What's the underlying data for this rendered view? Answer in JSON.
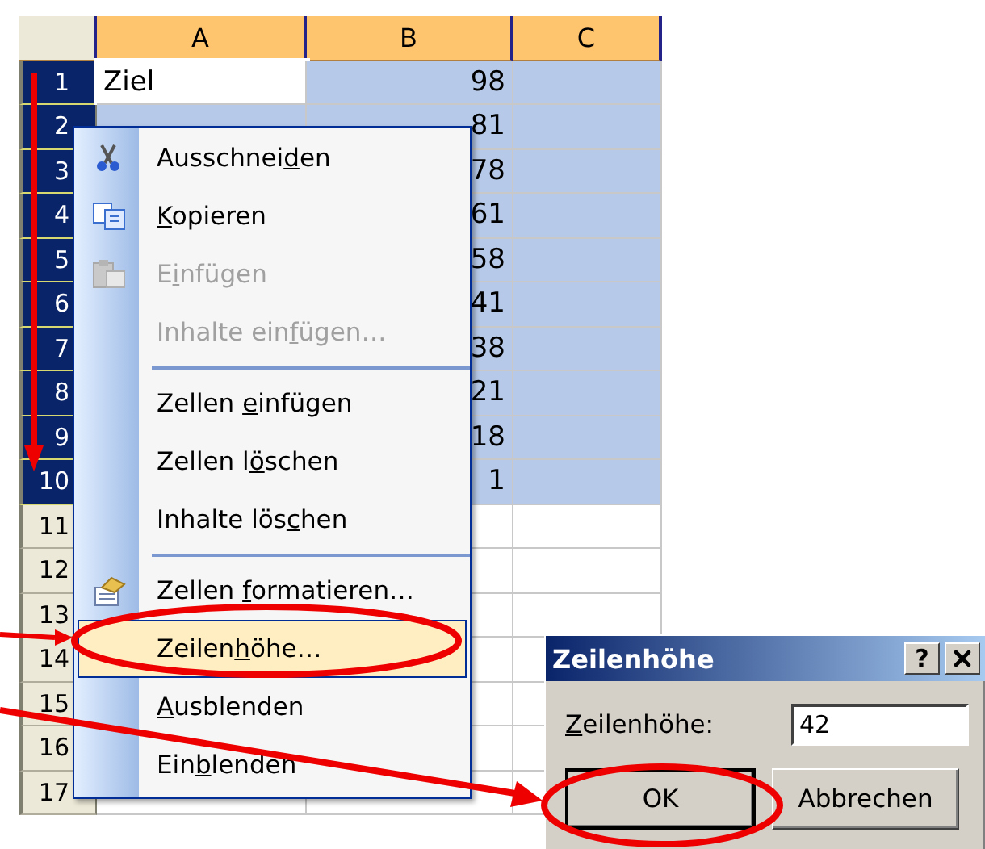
{
  "sheet": {
    "columns": [
      {
        "label": "A"
      },
      {
        "label": "B"
      },
      {
        "label": "C"
      }
    ],
    "rows": [
      {
        "number": "1",
        "selected": true,
        "cells": [
          {
            "text": "Ziel",
            "active": true
          },
          {
            "text": "98",
            "active": false
          },
          null
        ]
      },
      {
        "number": "2",
        "selected": true,
        "cells": [
          null,
          {
            "text": "81",
            "active": false
          },
          null
        ]
      },
      {
        "number": "3",
        "selected": true,
        "cells": [
          null,
          {
            "text": "78",
            "active": false
          },
          null
        ]
      },
      {
        "number": "4",
        "selected": true,
        "cells": [
          null,
          {
            "text": "61",
            "active": false
          },
          null
        ]
      },
      {
        "number": "5",
        "selected": true,
        "cells": [
          null,
          {
            "text": "58",
            "active": false
          },
          null
        ]
      },
      {
        "number": "6",
        "selected": true,
        "cells": [
          null,
          {
            "text": "41",
            "active": false
          },
          null
        ]
      },
      {
        "number": "7",
        "selected": true,
        "cells": [
          null,
          {
            "text": "38",
            "active": false
          },
          null
        ]
      },
      {
        "number": "8",
        "selected": true,
        "cells": [
          null,
          {
            "text": "21",
            "active": false
          },
          null
        ]
      },
      {
        "number": "9",
        "selected": true,
        "cells": [
          null,
          {
            "text": "18",
            "active": false
          },
          null
        ]
      },
      {
        "number": "10",
        "selected": true,
        "cells": [
          null,
          {
            "text": "1",
            "active": false
          },
          null
        ]
      },
      {
        "number": "11",
        "selected": false,
        "cells": [
          null,
          null,
          null
        ]
      },
      {
        "number": "12",
        "selected": false,
        "cells": [
          null,
          null,
          null
        ]
      },
      {
        "number": "13",
        "selected": false,
        "cells": [
          null,
          null,
          null
        ]
      },
      {
        "number": "14",
        "selected": false,
        "cells": [
          null,
          null,
          null
        ]
      },
      {
        "number": "15",
        "selected": false,
        "cells": [
          null,
          null,
          null
        ]
      },
      {
        "number": "16",
        "selected": false,
        "cells": [
          null,
          null,
          null
        ]
      },
      {
        "number": "17",
        "selected": false,
        "cells": [
          null,
          null,
          null
        ]
      }
    ]
  },
  "context_menu": {
    "items": [
      {
        "kind": "item",
        "before": "Ausschnei",
        "key": "d",
        "after": "en",
        "disabled": false,
        "selected": false
      },
      {
        "kind": "item",
        "key": "K",
        "after": "opieren",
        "disabled": false,
        "selected": false
      },
      {
        "kind": "item",
        "before": "E",
        "key": "i",
        "after": "nfügen",
        "disabled": true,
        "selected": false
      },
      {
        "kind": "item",
        "before": "Inhalte ein",
        "key": "f",
        "after": "ügen…",
        "disabled": true,
        "selected": false
      },
      {
        "kind": "separator"
      },
      {
        "kind": "item",
        "before": "Zellen ",
        "key": "e",
        "after": "infügen",
        "disabled": false,
        "selected": false
      },
      {
        "kind": "item",
        "before": "Zellen l",
        "key": "ö",
        "after": "schen",
        "disabled": false,
        "selected": false
      },
      {
        "kind": "item",
        "before": "Inhalte lös",
        "key": "c",
        "after": "hen",
        "disabled": false,
        "selected": false
      },
      {
        "kind": "separator"
      },
      {
        "kind": "item",
        "before": "Zellen ",
        "key": "f",
        "after": "ormatieren…",
        "disabled": false,
        "selected": false
      },
      {
        "kind": "item",
        "before": "Zeilen",
        "key": "h",
        "after": "öhe…",
        "disabled": false,
        "selected": true
      },
      {
        "kind": "item",
        "key": "A",
        "after": "usblenden",
        "disabled": false,
        "selected": false
      },
      {
        "kind": "item",
        "before": "Ein",
        "key": "b",
        "after": "l",
        "tail": "enden",
        "disabled": false,
        "selected": false
      }
    ]
  },
  "dialog": {
    "title": "Zeilenhöhe",
    "help": "?",
    "field": {
      "label_key": "Z",
      "label_rest": "eilenhöhe:",
      "value": "42"
    },
    "buttons": [
      {
        "label": "OK",
        "default": true
      },
      {
        "label": "Abbrechen",
        "default": false
      }
    ]
  }
}
